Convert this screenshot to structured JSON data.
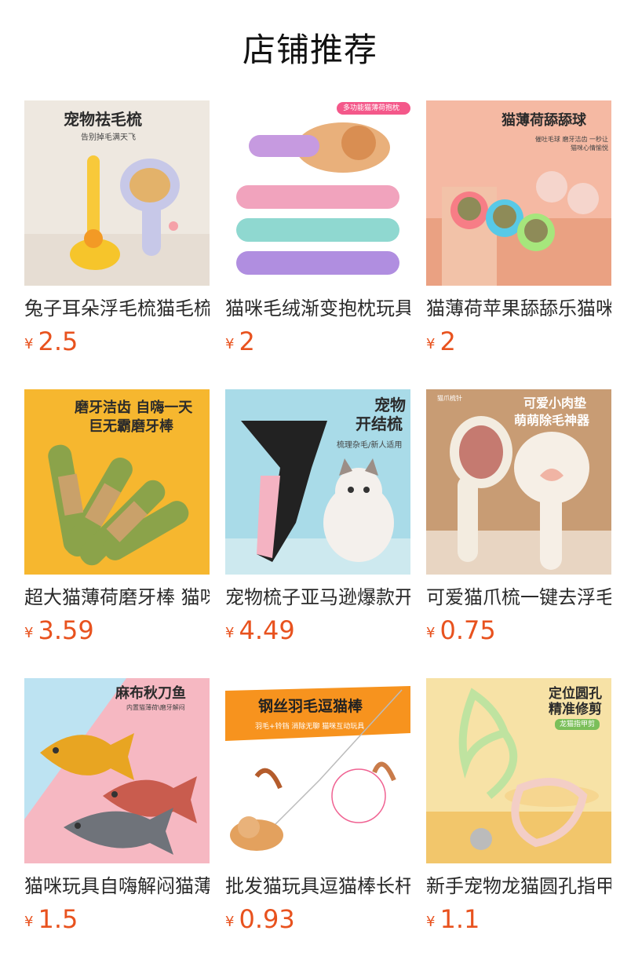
{
  "header": {
    "title": "店铺推荐"
  },
  "currency": "¥",
  "products": [
    {
      "name": "兔子耳朵浮毛梳猫毛梳",
      "price": "2.5",
      "image_text": {
        "title": "宠物祛毛梳",
        "subtitle": "告别掉毛满天飞"
      }
    },
    {
      "name": "猫咪毛绒渐变抱枕玩具",
      "price": "2",
      "image_text": {
        "title": "多功能猫薄荷抱枕",
        "subtitle": ""
      }
    },
    {
      "name": "猫薄荷苹果舔舔乐猫咪",
      "price": "2",
      "image_text": {
        "title": "猫薄荷舔舔球",
        "subtitle": "催吐毛球 磨牙洁齿 一秒让猫咪心情愉悦"
      }
    },
    {
      "name": "超大猫薄荷磨牙棒 猫咪",
      "price": "3.59",
      "image_text": {
        "title": "磨牙洁齿 自嗨一天",
        "subtitle": "巨无霸磨牙棒"
      }
    },
    {
      "name": "宠物梳子亚马逊爆款开结梳",
      "price": "4.49",
      "image_text": {
        "title": "宠物",
        "subtitle": "开结梳",
        "note": "梳理杂毛/新人适用"
      }
    },
    {
      "name": "可爱猫爪梳一键去浮毛",
      "price": "0.75",
      "image_text": {
        "title": "可爱小肉垫",
        "subtitle": "萌萌除毛神器",
        "tag": "猫爪梳针"
      }
    },
    {
      "name": "猫咪玩具自嗨解闷猫薄荷",
      "price": "1.5",
      "image_text": {
        "title": "麻布秋刀鱼",
        "subtitle": "内置猫薄荷\\磨牙解闷"
      }
    },
    {
      "name": "批发猫玩具逗猫棒长杆",
      "price": "0.93",
      "image_text": {
        "title": "钢丝羽毛逗猫棒",
        "subtitle": "羽毛+铃铛  消除无聊  猫咪互动玩具"
      }
    },
    {
      "name": "新手宠物龙猫圆孔指甲剪",
      "price": "1.1",
      "image_text": {
        "title": "定位圆孔",
        "subtitle": "精准修剪",
        "tag": "龙猫指甲剪"
      }
    }
  ]
}
